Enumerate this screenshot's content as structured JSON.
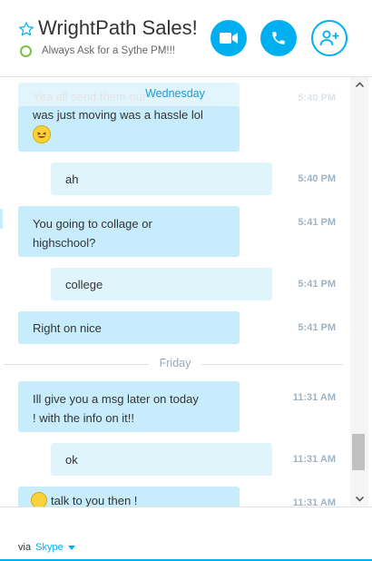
{
  "header": {
    "title": "WrightPath Sales!",
    "mood": "Always Ask for a Sythe PM!!!",
    "accent_color": "#00aff0",
    "presence_color": "#7ac143",
    "buttons": [
      {
        "icon": "video-camera-icon"
      },
      {
        "icon": "phone-icon"
      },
      {
        "icon": "add-contact-icon"
      }
    ]
  },
  "conversation": {
    "top_partial_text": "Yea all send them out",
    "top_partial_time": "5:40 PM",
    "sticky_day": "Wednesday",
    "messages": [
      {
        "sender": "them",
        "text": "was just moving was a hassle  lol",
        "time": "",
        "emoji": "laughing-emoji-icon"
      },
      {
        "sender": "me",
        "text": "ah",
        "time": "5:40 PM"
      },
      {
        "sender": "them",
        "line1": "You going to collage or",
        "line2": "highschool?",
        "time": "5:41 PM"
      },
      {
        "sender": "me",
        "text": "college",
        "time": "5:41 PM"
      },
      {
        "sender": "them",
        "text": "Right on  nice",
        "time": "5:41 PM"
      },
      {
        "sender": "them",
        "line1": "Ill give you  a msg later on today",
        "line2": "! with the info on it!!",
        "time": "11:31 AM"
      },
      {
        "sender": "me",
        "text": "ok",
        "time": "11:31 AM"
      },
      {
        "sender": "them",
        "text": "talk to you then !",
        "time": "11:31 AM",
        "emoji": "wave-emoji-icon"
      }
    ],
    "day_separator": "Friday"
  },
  "footer": {
    "via_label": "via",
    "service": "Skype"
  }
}
